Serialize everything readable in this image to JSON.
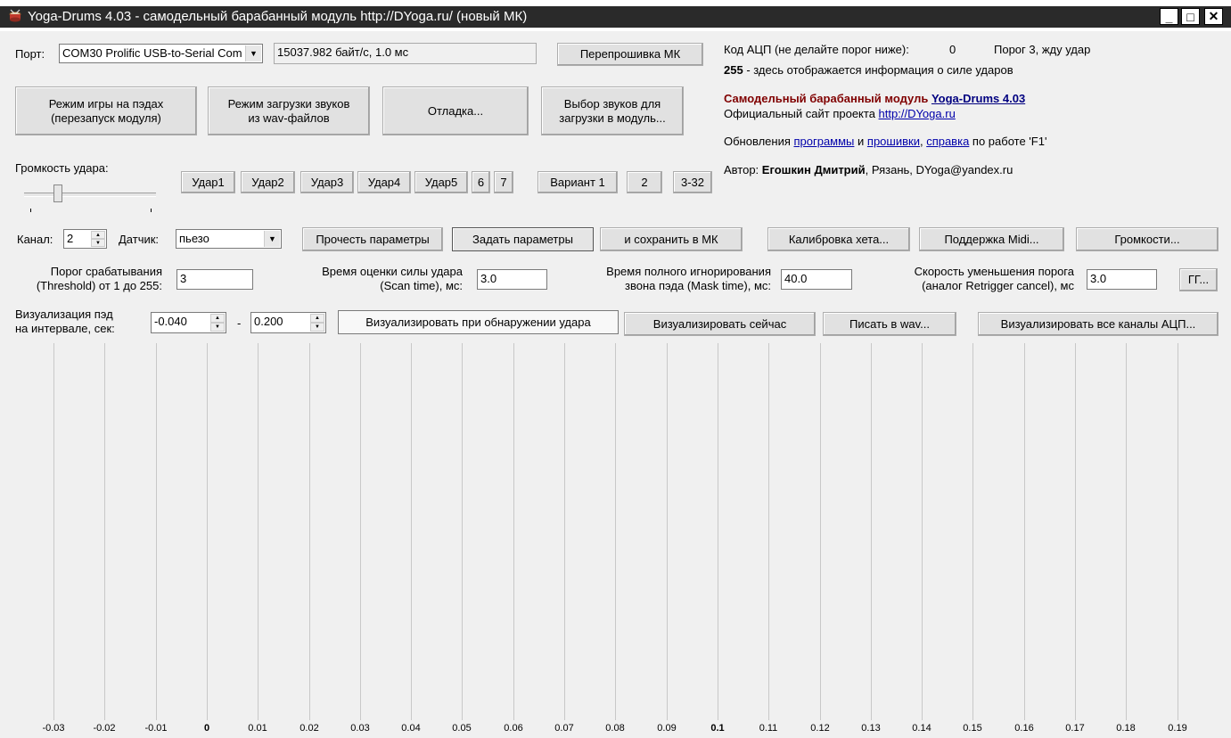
{
  "window": {
    "title": "Yoga-Drums 4.03 - самодельный барабанный модуль http://DYoga.ru/ (новый МК)",
    "minimize_label": "_",
    "maximize_label": "□",
    "close_label": "✕"
  },
  "port": {
    "label": "Порт:",
    "selected": "COM30 Prolific USB-to-Serial Com",
    "rate": "15037.982 байт/с, 1.0 мс",
    "flash_button": "Перепрошивка МК"
  },
  "mode_buttons": {
    "play": "Режим игры на пэдах\n(перезапуск модуля)",
    "load_wav": "Режим загрузки звуков\nиз wav-файлов",
    "debug": "Отладка...",
    "choose_sounds": "Выбор звуков для\nзагрузки в модуль..."
  },
  "info": {
    "adc_label": "Код АЦП (не делайте порог ниже):",
    "adc_value": "0",
    "threshold_status": "Порог 3, жду удар",
    "hit_value": "255",
    "hit_text": " - здесь отображается информация о силе ударов",
    "module_title": "Самодельный барабанный модуль ",
    "module_link": "Yoga-Drums 4.03",
    "site_text": "Официальный сайт проекта ",
    "site_link": "http://DYoga.ru",
    "updates_prefix": "Обновления ",
    "updates_program": "программы",
    "updates_and": " и ",
    "updates_firmware": "прошивки",
    "updates_comma": ", ",
    "updates_help": "справка",
    "updates_suffix": " по работе 'F1'",
    "author_prefix": "Автор: ",
    "author_name": "Егошкин Дмитрий",
    "author_suffix": ", Рязань, DYoga@yandex.ru"
  },
  "volume": {
    "label": "Громкость удара:",
    "level": 0.25
  },
  "hit_buttons": [
    "Удар1",
    "Удар2",
    "Удар3",
    "Удар4",
    "Удар5",
    "6",
    "7"
  ],
  "variant_buttons": [
    "Вариант 1",
    "2",
    "3-32"
  ],
  "channel": {
    "label": "Канал:",
    "value": "2",
    "sensor_label": "Датчик:",
    "sensor_value": "пьезо",
    "read_params": "Прочесть параметры",
    "set_params": "Задать параметры",
    "save_mk": "и сохранить в МК",
    "hihat_calibration": "Калибровка хета...",
    "midi_support": "Поддержка Midi...",
    "volumes": "Громкости..."
  },
  "params": {
    "threshold_label_1": "Порог срабатывания",
    "threshold_label_2": "(Threshold) от 1 до 255:",
    "threshold_value": "3",
    "scan_label_1": "Время оценки силы удара",
    "scan_label_2": "(Scan time), мс:",
    "scan_value": "3.0",
    "mask_label_1": "Время полного игнорирования",
    "mask_label_2": "звона пэда (Mask time), мс:",
    "mask_value": "40.0",
    "retrigger_label_1": "Скорость уменьшения порога",
    "retrigger_label_2": "(аналог Retrigger cancel), мс",
    "retrigger_value": "3.0",
    "gg_button": "ГГ..."
  },
  "visualize": {
    "label_1": "Визуализация пэд",
    "label_2": "на интервале, сек:",
    "from_value": "-0.040",
    "dash": "-",
    "to_value": "0.200",
    "on_hit": "Визуализировать при обнаружении удара",
    "now": "Визуализировать сейчас",
    "write_wav": "Писать в wav...",
    "all_channels": "Визуализировать все каналы АЦП..."
  },
  "axis_ticks": [
    "-0.03",
    "-0.02",
    "-0.01",
    "0",
    "0.01",
    "0.02",
    "0.03",
    "0.04",
    "0.05",
    "0.06",
    "0.07",
    "0.08",
    "0.09",
    "0.1",
    "0.11",
    "0.12",
    "0.13",
    "0.14",
    "0.15",
    "0.16",
    "0.17",
    "0.18",
    "0.19"
  ]
}
